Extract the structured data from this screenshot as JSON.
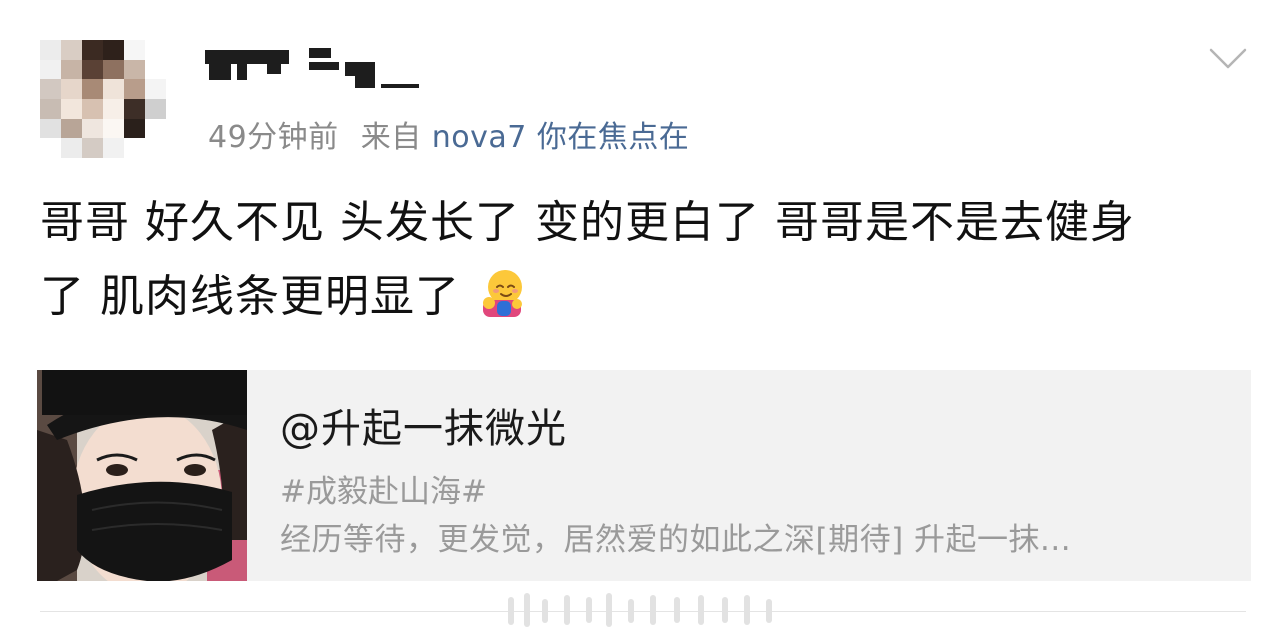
{
  "post": {
    "time": "49分钟前",
    "source_prefix": "来自",
    "source_device": "nova7 你在焦点在",
    "text_line1": "哥哥 好久不见 头发长了 变的更白了 哥哥是不是去健身",
    "text_line2": "了 肌肉线条更明显了",
    "emoji": "hugging-face-emoji"
  },
  "repost": {
    "author": "@升起一抹微光",
    "hashtag": "#成毅赴山海#",
    "excerpt": "经历等待，更发觉，居然爱的如此之深[期待] 升起一抹..."
  },
  "icons": {
    "menu": "chevron-down-icon"
  },
  "colors": {
    "link": "#4a6a94",
    "meta_gray": "#8a8a8a",
    "repost_bg": "#f2f2f2"
  }
}
